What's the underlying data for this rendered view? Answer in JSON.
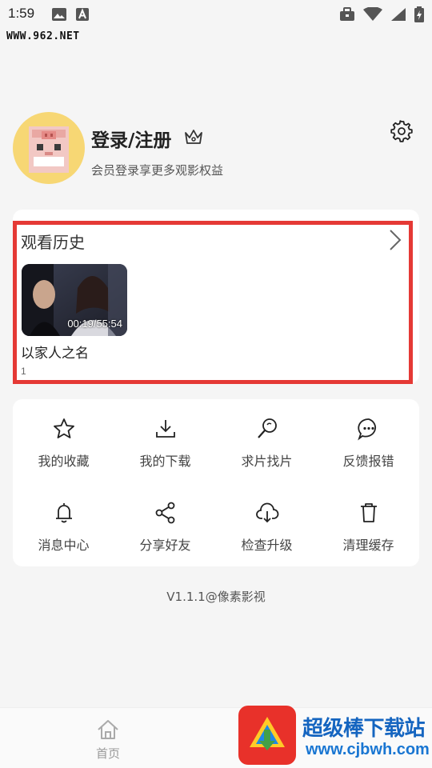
{
  "status_bar": {
    "time": "1:59"
  },
  "watermark_top": "WWW.962.NET",
  "profile": {
    "title": "登录/注册",
    "subtitle": "会员登录享更多观影权益"
  },
  "history": {
    "title": "观看历史",
    "items": [
      {
        "time": "00:19/55:54",
        "name": "以家人之名",
        "episode": "1"
      }
    ]
  },
  "menu": [
    {
      "label": "我的收藏",
      "icon": "star-icon"
    },
    {
      "label": "我的下载",
      "icon": "download-icon"
    },
    {
      "label": "求片找片",
      "icon": "search-icon"
    },
    {
      "label": "反馈报错",
      "icon": "chat-icon"
    },
    {
      "label": "消息中心",
      "icon": "bell-icon"
    },
    {
      "label": "分享好友",
      "icon": "share-icon"
    },
    {
      "label": "检查升级",
      "icon": "cloud-download-icon"
    },
    {
      "label": "清理缓存",
      "icon": "trash-icon"
    }
  ],
  "version": "V1.1.1@像素影视",
  "bottom_nav": {
    "home_label": "首页"
  },
  "brand_watermark": {
    "name": "超级棒下载站",
    "url": "www.cjbwh.com"
  },
  "colors": {
    "highlight": "#e53935",
    "avatar_bg": "#f7d774",
    "brand_blue": "#1565c0"
  }
}
